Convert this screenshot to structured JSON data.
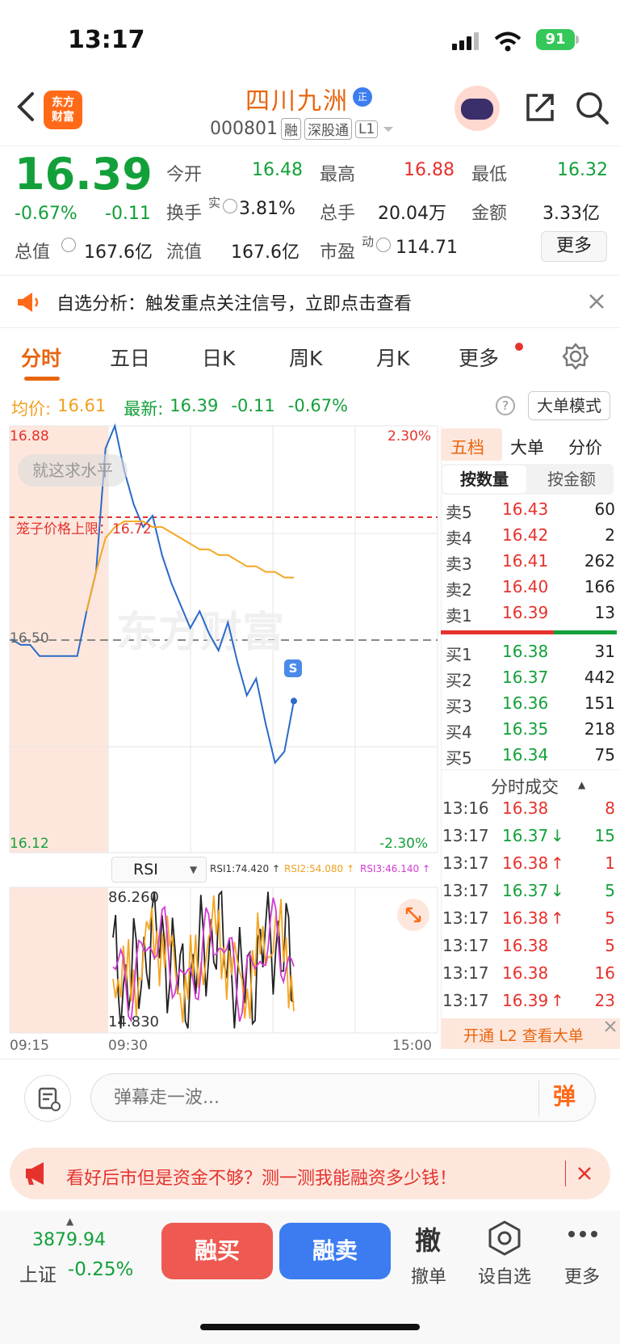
{
  "status_bar": {
    "time": "13:17",
    "battery": "91"
  },
  "nav": {
    "logo_line1": "东方",
    "logo_line2": "财富",
    "stock_name": "四川九洲",
    "name_badge": "正",
    "stock_code": "000801",
    "tags": [
      "融",
      "深股通",
      "L1"
    ]
  },
  "quote": {
    "price": "16.39",
    "change_pct": "-0.67%",
    "change": "-0.11",
    "open_label": "今开",
    "open": "16.48",
    "high_label": "最高",
    "high": "16.88",
    "low_label": "最低",
    "low": "16.32",
    "turnover_label": "换手",
    "turnover_sup": "实",
    "turnover": "3.81%",
    "volume_label": "总手",
    "volume": "20.04万",
    "amount_label": "金额",
    "amount": "3.33亿",
    "mktcap_label": "总值",
    "mktcap": "167.6亿",
    "float_label": "流值",
    "float": "167.6亿",
    "pe_label": "市盈",
    "pe_sup": "动",
    "pe": "114.71",
    "more": "更多"
  },
  "notice": {
    "text": "自选分析：触发重点关注信号，立即点击查看"
  },
  "tabs": [
    "分时",
    "五日",
    "日K",
    "周K",
    "月K",
    "更多"
  ],
  "info_line": {
    "avg_label": "均价:",
    "avg": "16.61",
    "latest_label": "最新:",
    "latest": "16.39",
    "chg": "-0.11",
    "pct": "-0.67%",
    "mode_button": "大单模式"
  },
  "chart": {
    "y_top": "16.88",
    "y_bottom": "16.12",
    "y_mid": "16.50",
    "pct_top": "2.30%",
    "pct_bottom": "-2.30%",
    "level_label": "就这求水平",
    "limit_label": "笼子价格上限：16.72",
    "watermark": "东方财富",
    "s_marker": "S",
    "time_start": "09:15",
    "time_open": "09:30",
    "time_end": "15:00",
    "rsi_selector": "RSI",
    "rsi1": "RSI1:74.420 ↑",
    "rsi2": "RSI2:54.080 ↑",
    "rsi3": "RSI3:46.140 ↑",
    "rsi_top": "86.260",
    "rsi_bottom": "14.830",
    "price_line_color": "#2a6ac8",
    "avg_line_color": "#f5a623"
  },
  "chart_data": {
    "type": "line",
    "title": "",
    "ylim": [
      16.12,
      16.88
    ],
    "series": [
      {
        "name": "最新",
        "values": [
          16.5,
          16.49,
          16.49,
          16.47,
          16.47,
          16.47,
          16.47,
          16.47,
          16.55,
          16.62,
          16.84,
          16.88,
          16.8,
          16.74,
          16.7,
          16.72,
          16.65,
          16.6,
          16.56,
          16.52,
          16.55,
          16.51,
          16.48,
          16.53,
          16.46,
          16.4,
          16.43,
          16.35,
          16.28,
          16.3,
          16.39
        ]
      },
      {
        "name": "均价",
        "values": [
          null,
          null,
          null,
          null,
          null,
          null,
          null,
          null,
          16.55,
          16.62,
          16.68,
          16.7,
          16.71,
          16.71,
          16.71,
          16.7,
          16.7,
          16.69,
          16.68,
          16.67,
          16.66,
          16.66,
          16.65,
          16.65,
          16.64,
          16.63,
          16.63,
          16.62,
          16.62,
          16.61,
          16.61
        ]
      }
    ]
  },
  "order_book": {
    "tabs": [
      "五档",
      "大单",
      "分价"
    ],
    "subtabs": [
      "按数量",
      "按金额"
    ],
    "asks": [
      {
        "label": "卖5",
        "price": "16.43",
        "qty": "60"
      },
      {
        "label": "卖4",
        "price": "16.42",
        "qty": "2"
      },
      {
        "label": "卖3",
        "price": "16.41",
        "qty": "262"
      },
      {
        "label": "卖2",
        "price": "16.40",
        "qty": "166"
      },
      {
        "label": "卖1",
        "price": "16.39",
        "qty": "13"
      }
    ],
    "bids": [
      {
        "label": "买1",
        "price": "16.38",
        "qty": "31"
      },
      {
        "label": "买2",
        "price": "16.37",
        "qty": "442"
      },
      {
        "label": "买3",
        "price": "16.36",
        "qty": "151"
      },
      {
        "label": "买4",
        "price": "16.35",
        "qty": "218"
      },
      {
        "label": "买5",
        "price": "16.34",
        "qty": "75"
      }
    ],
    "trades_title": "分时成交",
    "trades": [
      {
        "time": "13:16",
        "price": "16.38",
        "dir": "",
        "qty": "8"
      },
      {
        "time": "13:17",
        "price": "16.37",
        "dir": "↓",
        "qty": "15"
      },
      {
        "time": "13:17",
        "price": "16.38",
        "dir": "↑",
        "qty": "1"
      },
      {
        "time": "13:17",
        "price": "16.37",
        "dir": "↓",
        "qty": "5"
      },
      {
        "time": "13:17",
        "price": "16.38",
        "dir": "↑",
        "qty": "5"
      },
      {
        "time": "13:17",
        "price": "16.38",
        "dir": "",
        "qty": "5"
      },
      {
        "time": "13:17",
        "price": "16.38",
        "dir": "",
        "qty": "16"
      },
      {
        "time": "13:17",
        "price": "16.39",
        "dir": "↑",
        "qty": "23"
      }
    ],
    "l2_promo": "开通 L2 查看大单"
  },
  "comment": {
    "placeholder": "弹幕走一波...",
    "danmu_icon": "弹"
  },
  "promo": {
    "text": "看好后市但是资金不够？测一测我能融资多少钱！"
  },
  "bottom": {
    "index_value": "3879.94",
    "index_name": "上证",
    "index_pct": "-0.25%",
    "buy": "融买",
    "sell": "融卖",
    "cancel_glyph": "撤",
    "cancel": "撤单",
    "watchlist": "设自选",
    "more": "更多"
  }
}
